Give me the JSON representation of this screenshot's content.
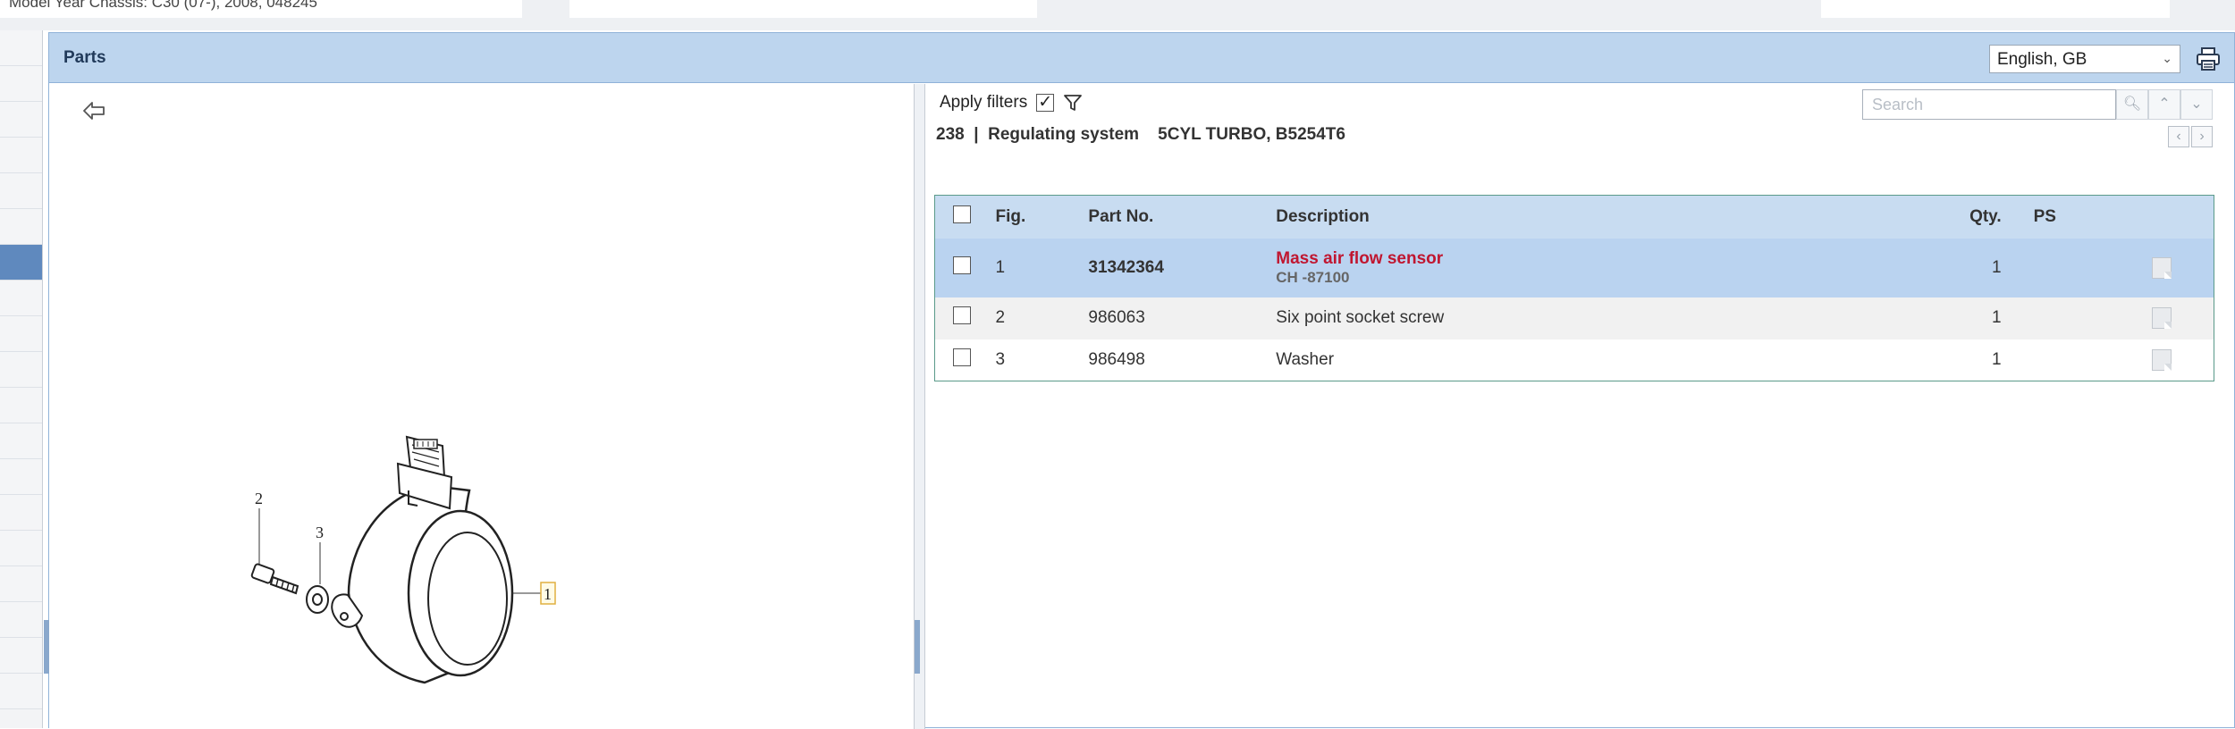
{
  "top": {
    "info_text": "Model Year Chassis: C30 (07-), 2008, 048245"
  },
  "header": {
    "title": "Parts",
    "language": "English, GB"
  },
  "filters": {
    "apply_label": "Apply filters",
    "apply_checked": true
  },
  "search": {
    "placeholder": "Search"
  },
  "breadcrumb": {
    "text": "238  |  Regulating system    5CYL TURBO, B5254T6"
  },
  "table": {
    "columns": {
      "fig": "Fig.",
      "part": "Part No.",
      "desc": "Description",
      "qty": "Qty.",
      "ps": "PS"
    },
    "rows": [
      {
        "fig": "1",
        "part": "31342364",
        "desc": "Mass air flow sensor",
        "sub": "CH -87100",
        "qty": "1"
      },
      {
        "fig": "2",
        "part": "986063",
        "desc": "Six point socket screw",
        "sub": "",
        "qty": "1"
      },
      {
        "fig": "3",
        "part": "986498",
        "desc": "Washer",
        "sub": "",
        "qty": "1"
      }
    ]
  },
  "illustration": {
    "callouts": [
      "2",
      "3",
      "1"
    ]
  },
  "icons": {
    "back": "back-arrow-icon",
    "filter": "funnel-icon",
    "print": "printer-icon",
    "search": "magnifier-icon"
  }
}
